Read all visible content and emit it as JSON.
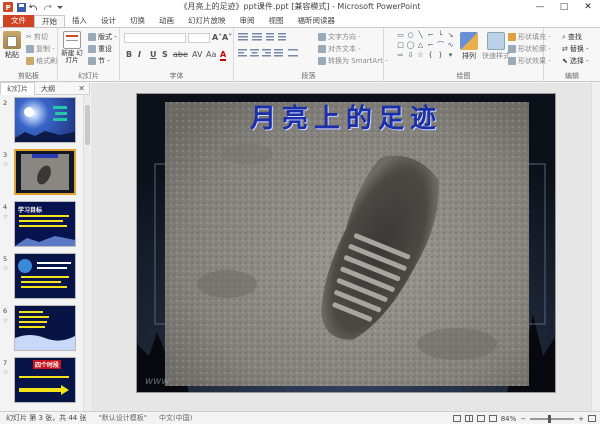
{
  "window": {
    "title": "《月亮上的足迹》ppt课件.ppt [兼容模式] - Microsoft PowerPoint"
  },
  "quick_access": [
    "save-icon",
    "undo-icon",
    "redo-icon",
    "customize-icon"
  ],
  "window_controls": {
    "minimize": "—",
    "maximize": "□",
    "close": "✕"
  },
  "tabs": [
    {
      "label": "文件",
      "kind": "file"
    },
    {
      "label": "开始",
      "kind": "active"
    },
    {
      "label": "插入"
    },
    {
      "label": "设计"
    },
    {
      "label": "切换"
    },
    {
      "label": "动画"
    },
    {
      "label": "幻灯片放映"
    },
    {
      "label": "审阅"
    },
    {
      "label": "视图"
    },
    {
      "label": "福昕阅读器"
    }
  ],
  "ribbon": {
    "clipboard": {
      "label": "剪贴板",
      "paste": "粘贴",
      "cut": "剪切",
      "copy": "复制 -",
      "format_painter": "格式刷"
    },
    "slides": {
      "label": "幻灯片",
      "new_slide": "新建 幻灯片",
      "layout": "版式 -",
      "reset": "重设",
      "section": "节 -"
    },
    "font": {
      "label": "字体",
      "font_name": "",
      "font_size": "",
      "bold": "B",
      "italic": "I",
      "underline": "U",
      "strike": "S",
      "shadow": "abe",
      "spacing": "AV",
      "case": "Aa",
      "color": "A",
      "grow": "A˄",
      "shrink": "A˅",
      "clear": "A"
    },
    "paragraph": {
      "label": "段落",
      "text_direction": "文字方向 -",
      "align_text": "对齐文本 -",
      "smartart": "转换为 SmartArt -"
    },
    "drawing": {
      "label": "绘图",
      "arrange": "排列",
      "quick_styles": "快速样式",
      "shape_fill": "形状填充 -",
      "shape_outline": "形状轮廓 -",
      "shape_effects": "形状效果 -"
    },
    "editing": {
      "label": "编辑",
      "find": "查找",
      "replace": "替换 -",
      "select": "选择 -"
    }
  },
  "panel": {
    "tabs": [
      {
        "label": "幻灯片",
        "active": true
      },
      {
        "label": "大纲",
        "active": false
      }
    ],
    "close": "✕",
    "slides": [
      {
        "num": "2",
        "selected": false,
        "theme": "moon"
      },
      {
        "num": "3",
        "selected": true,
        "theme": "footprint"
      },
      {
        "num": "4",
        "selected": false,
        "theme": "goals",
        "title": "学习目标"
      },
      {
        "num": "5",
        "selected": false,
        "theme": "earth"
      },
      {
        "num": "6",
        "selected": false,
        "theme": "night"
      },
      {
        "num": "7",
        "selected": false,
        "theme": "arrow",
        "title": "四个时段"
      }
    ]
  },
  "slide": {
    "title": "月亮上的足迹",
    "title_color": "#1b2fa8"
  },
  "status": {
    "slide_info": "幻灯片 第 3 张，共 44 张",
    "theme": "\"默认设计模板\"",
    "language": "中文(中国)",
    "zoom": "84%",
    "zoom_fraction": 0.42
  },
  "colors": {
    "file_tab": "#d04423",
    "selected_thumb": "#e3a033"
  }
}
